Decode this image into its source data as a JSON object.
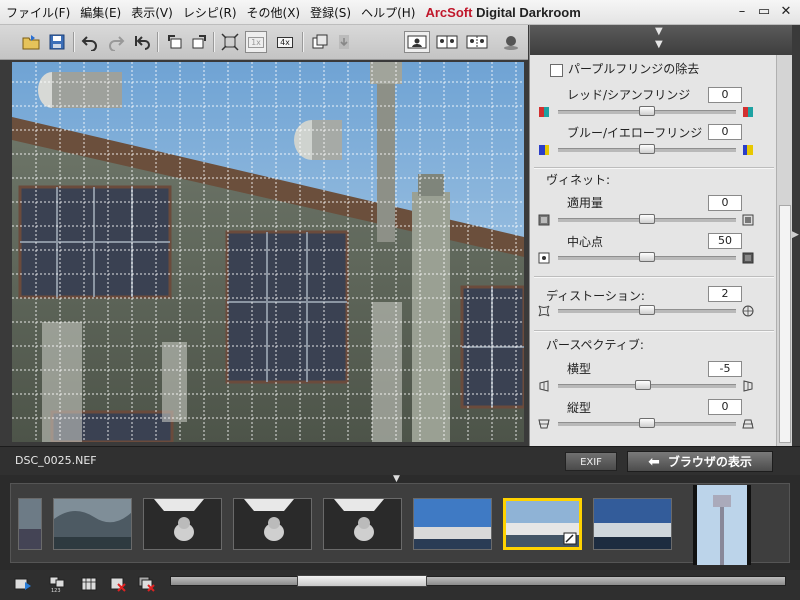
{
  "menu": {
    "items": [
      "ファイル(F)",
      "編集(E)",
      "表示(V)",
      "レシピ(R)",
      "その他(X)",
      "登録(S)",
      "ヘルプ(H)"
    ],
    "brand_a": "ArcSoft",
    "brand_b": "Digital Darkroom"
  },
  "window": {
    "minimize": "–",
    "restore": "▭",
    "close": "✕"
  },
  "toolbar": {
    "zoom_1x": "1x",
    "zoom_4x": "4x"
  },
  "status": {
    "filename": "DSC_0025.NEF",
    "exif_label": "EXIF",
    "browser_label": "ブラウザの表示"
  },
  "panel": {
    "purple_fringe_label": "パープルフリンジの除去",
    "purple_fringe_checked": false,
    "red_cyan": {
      "label": "レッド/シアンフリンジ",
      "value": "0",
      "pos": 0.5
    },
    "blue_yellow": {
      "label": "ブルー/イエローフリンジ",
      "value": "0",
      "pos": 0.5
    },
    "vignette_title": "ヴィネット:",
    "vignette_amount": {
      "label": "適用量",
      "value": "0",
      "pos": 0.5
    },
    "vignette_center": {
      "label": "中心点",
      "value": "50",
      "pos": 0.5
    },
    "distortion": {
      "label": "ディストーション:",
      "value": "2",
      "pos": 0.5
    },
    "perspective_title": "パースペクティブ:",
    "horizontal": {
      "label": "横型",
      "value": "-5",
      "pos": 0.48
    },
    "vertical": {
      "label": "縦型",
      "value": "0",
      "pos": 0.5
    }
  },
  "zoom_slider": {
    "pos": 0.26
  },
  "colors": {
    "selection": "#ffd200",
    "brand_red": "#c0172b"
  }
}
